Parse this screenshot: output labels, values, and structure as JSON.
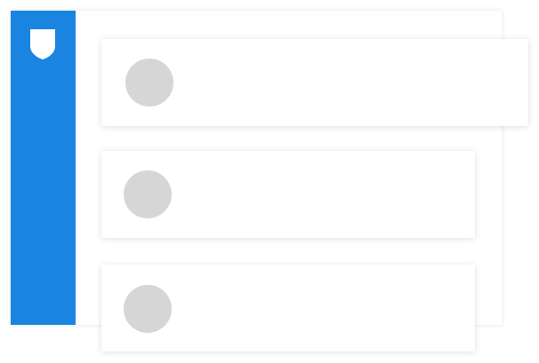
{
  "sidebar": {
    "icon": "shield-icon",
    "color": "#1a85e0"
  },
  "cards": [
    {
      "avatar": "avatar-placeholder"
    },
    {
      "avatar": "avatar-placeholder"
    },
    {
      "avatar": "avatar-placeholder"
    }
  ],
  "colors": {
    "accent": "#1a85e0",
    "avatar_placeholder": "#d6d6d6",
    "background": "#ffffff"
  }
}
